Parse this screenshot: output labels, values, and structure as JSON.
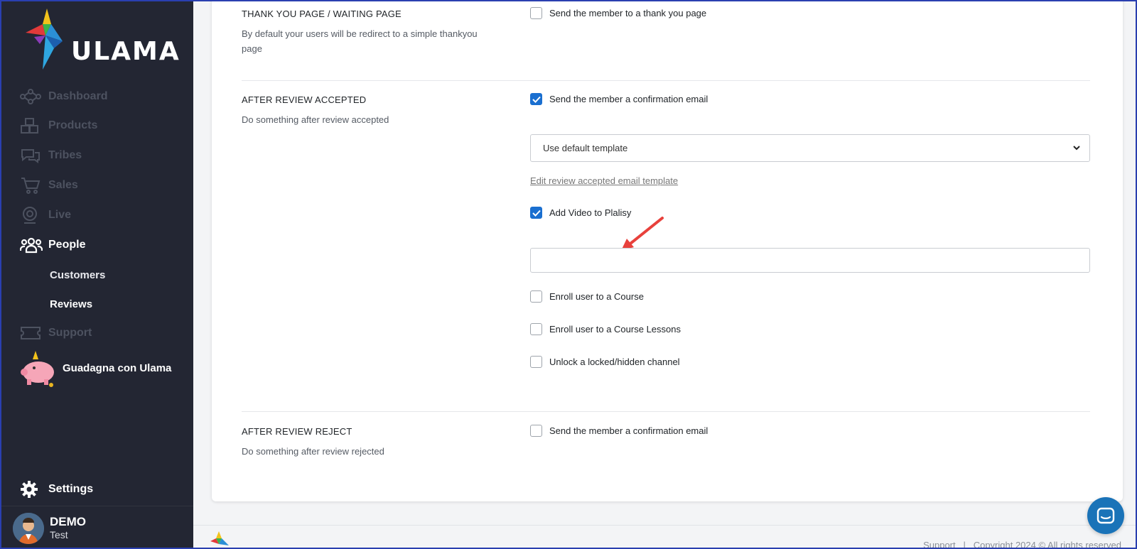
{
  "brand": {
    "logo_text": "ULAMA"
  },
  "sidebar": {
    "items": [
      {
        "label": "Dashboard",
        "icon": "share-nodes-icon"
      },
      {
        "label": "Products",
        "icon": "boxes-icon"
      },
      {
        "label": "Tribes",
        "icon": "chat-bubbles-icon"
      },
      {
        "label": "Sales",
        "icon": "cart-icon"
      },
      {
        "label": "Live",
        "icon": "webcam-icon"
      },
      {
        "label": "People",
        "icon": "people-group-icon"
      }
    ],
    "sub_items": [
      {
        "label": "Customers"
      },
      {
        "label": "Reviews"
      }
    ],
    "support": {
      "label": "Support",
      "icon": "ticket-icon"
    },
    "promo": {
      "label": "Guadagna con Ulama",
      "icon": "piggy-bank-icon"
    },
    "settings": {
      "label": "Settings",
      "icon": "gear-icon"
    },
    "user": {
      "name": "DEMO",
      "role": "Test"
    }
  },
  "sections": {
    "thankyou": {
      "title": "THANK YOU PAGE / WAITING PAGE",
      "description": "By default your users will be redirect to a simple thankyou page",
      "checkbox_label": "Send the member to a thank you page",
      "checked": false
    },
    "accepted": {
      "title": "AFTER REVIEW ACCEPTED",
      "description": "Do something after review accepted",
      "confirm_label": "Send the member a confirmation email",
      "confirm_checked": true,
      "template_select": "Use default template",
      "edit_link": "Edit review accepted email template",
      "video_label": "Add Video to Plalisy",
      "video_checked": true,
      "video_input_value": "",
      "enroll_course_label": "Enroll user to a Course",
      "enroll_lessons_label": "Enroll user to a Course Lessons",
      "unlock_channel_label": "Unlock a locked/hidden channel"
    },
    "rejected": {
      "title": "AFTER REVIEW REJECT",
      "description": "Do something after review rejected",
      "confirm_label": "Send the member a confirmation email",
      "confirm_checked": false
    }
  },
  "footer": {
    "support_link": "Support",
    "separator": "|",
    "copyright": "Copyright 2024 © All rights reserved"
  },
  "colors": {
    "accent": "#1a6fd0",
    "sidebar_bg": "#232633",
    "arrow": "#e8413c"
  }
}
